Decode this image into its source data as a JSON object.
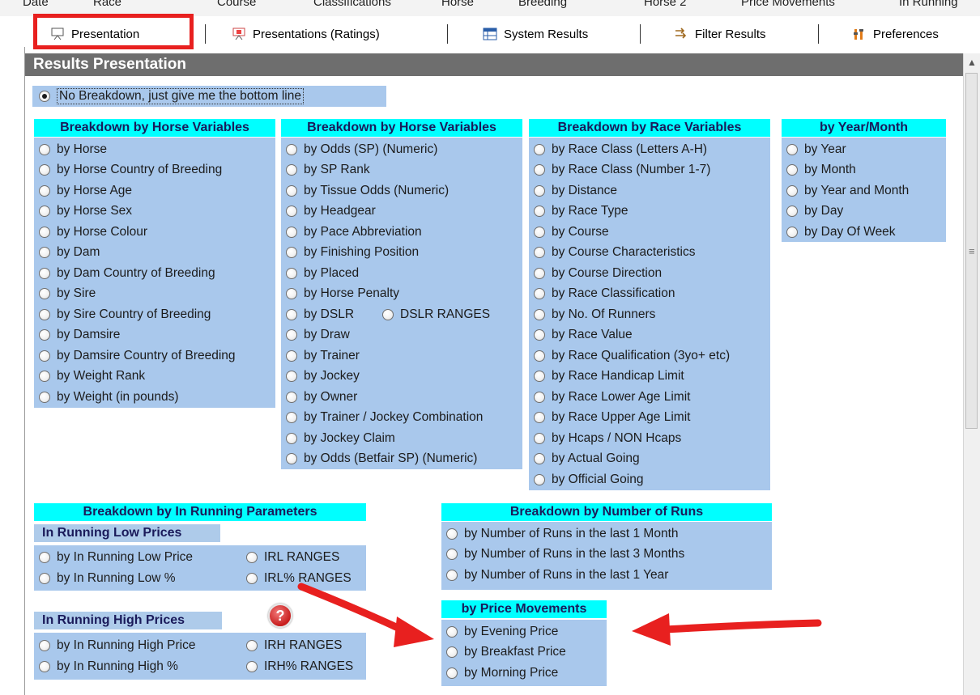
{
  "top_tabs": [
    "Date",
    "Race",
    "Course",
    "Classifications",
    "Horse",
    "Breeding",
    "Horse 2",
    "Price Movements",
    "In Running"
  ],
  "tabs": [
    {
      "label": "Presentation",
      "icon": "presentation-icon"
    },
    {
      "label": "Presentations (Ratings)",
      "icon": "presentation-ratings-icon"
    },
    {
      "label": "System Results",
      "icon": "table-icon"
    },
    {
      "label": "Filter Results",
      "icon": "filter-arrows-icon"
    },
    {
      "label": "Preferences",
      "icon": "preferences-icon"
    }
  ],
  "panel": {
    "title": "Results Presentation"
  },
  "no_breakdown": {
    "label": "No Breakdown, just give me the bottom line",
    "selected": true
  },
  "groups": {
    "horse1": {
      "title": "Breakdown by Horse Variables",
      "options": [
        "by Horse",
        "by Horse Country of Breeding",
        "by Horse Age",
        "by Horse Sex",
        "by Horse Colour",
        "by Dam",
        "by Dam Country of Breeding",
        "by Sire",
        "by Sire Country of Breeding",
        "by Damsire",
        "by Damsire Country of Breeding",
        "by Weight Rank",
        "by Weight (in pounds)"
      ]
    },
    "horse2": {
      "title": "Breakdown by Horse Variables",
      "options": [
        "by Odds (SP) (Numeric)",
        "by SP Rank",
        "by Tissue Odds (Numeric)",
        "by Headgear",
        "by Pace Abbreviation",
        "by Finishing Position",
        "by Placed",
        "by Horse Penalty",
        "by DSLR",
        "by Draw",
        "by Trainer",
        "by Jockey",
        "by Owner",
        "by Trainer / Jockey Combination",
        "by Jockey Claim",
        "by Odds (Betfair SP) (Numeric)"
      ],
      "extra": "DSLR RANGES"
    },
    "race": {
      "title": "Breakdown by Race Variables",
      "options": [
        "by Race Class (Letters A-H)",
        "by Race Class (Number 1-7)",
        "by Distance",
        "by Race Type",
        "by Course",
        "by Course Characteristics",
        "by Course Direction",
        "by Race Classification",
        "by No. Of Runners",
        "by Race Value",
        "by Race Qualification (3yo+ etc)",
        "by Race Handicap Limit",
        "by Race Lower Age Limit",
        "by Race Upper Age Limit",
        "by Hcaps / NON Hcaps",
        "by Actual Going",
        "by Official Going"
      ]
    },
    "yearmonth": {
      "title": "by Year/Month",
      "options": [
        "by Year",
        "by Month",
        "by Year and Month",
        "by Day",
        "by Day Of Week"
      ]
    },
    "inrunning": {
      "title": "Breakdown by In Running Parameters",
      "low_title": "In Running Low Prices",
      "low_options": [
        "by In Running Low Price",
        "by In Running Low %"
      ],
      "low_ranges": [
        "IRL RANGES",
        "IRL% RANGES"
      ],
      "high_title": "In Running High Prices",
      "high_options": [
        "by In Running High Price",
        "by In Running High %"
      ],
      "high_ranges": [
        "IRH RANGES",
        "IRH% RANGES"
      ]
    },
    "runs": {
      "title": "Breakdown by Number of Runs",
      "options": [
        "by Number of Runs in the last 1 Month",
        "by Number of Runs in the last 3 Months",
        "by Number of Runs in the last 1 Year"
      ]
    },
    "price": {
      "title": "by Price Movements",
      "options": [
        "by Evening Price",
        "by Breakfast Price",
        "by Morning Price"
      ]
    }
  },
  "help_symbol": "?",
  "colors": {
    "header": "#6e6e6e",
    "group_title": "#00ffff",
    "group_box": "#a9c8ec",
    "annotation_red": "#e8201f"
  }
}
